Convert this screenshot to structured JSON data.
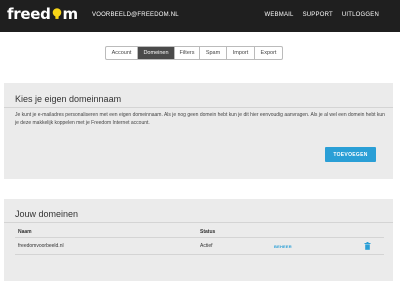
{
  "brand": {
    "logo_text_start": "freed",
    "logo_text_end": "m",
    "account_email": "VOORBEELD@FREEDOM.NL"
  },
  "topnav": [
    "WEBMAIL",
    "SUPPORT",
    "UITLOGGEN"
  ],
  "tabs": [
    {
      "label": "Account",
      "active": false
    },
    {
      "label": "Domeinen",
      "active": true
    },
    {
      "label": "Filters",
      "active": false
    },
    {
      "label": "Spam",
      "active": false
    },
    {
      "label": "Import",
      "active": false
    },
    {
      "label": "Export",
      "active": false
    }
  ],
  "choose_domain": {
    "title": "Kies je eigen domeinnaam",
    "text": "Je kunt je e-mailadres personaliseren met een eigen domeinnaam. Als je nog geen domein hebt kun je dit hier eenvoudig aanvragen. Als je al wel een domein hebt kun je deze makkelijk koppelen met je Freedom Internet account.",
    "button": "TOEVOEGEN"
  },
  "your_domains": {
    "title": "Jouw domeinen",
    "columns": [
      "Naam",
      "Status"
    ],
    "rows": [
      {
        "name": "freedomvoorbeeld.nl",
        "status": "Actief",
        "action": "BEHEER"
      }
    ]
  },
  "colors": {
    "topbar": "#1f1f1f",
    "accent": "#2a9fd6",
    "logo_bulb": "#f7d417",
    "panel_bg": "#ebebeb"
  },
  "icons": [
    "lightbulb-icon",
    "trash-icon"
  ]
}
